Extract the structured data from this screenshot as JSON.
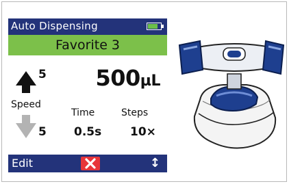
{
  "screen": {
    "title": "Auto Dispensing",
    "battery_level": 0.85,
    "favorite": "Favorite 3",
    "speed_up_value": "5",
    "speed_label": "Speed",
    "speed_down_value": "5",
    "volume_value": "500",
    "volume_unit": "µL",
    "time_label": "Time",
    "time_value": "0.5s",
    "steps_label": "Steps",
    "steps_value": "10×",
    "edit_label": "Edit",
    "updown_symbol": "↕",
    "colors": {
      "header": "#23337a",
      "favorite_bar": "#7cc04a",
      "cancel": "#e8353a"
    }
  },
  "icons": {
    "up_arrow": "up-arrow-icon",
    "down_arrow": "down-arrow-icon",
    "cancel": "close-icon",
    "scroll": "up-down-arrow-icon",
    "battery": "battery-icon"
  }
}
